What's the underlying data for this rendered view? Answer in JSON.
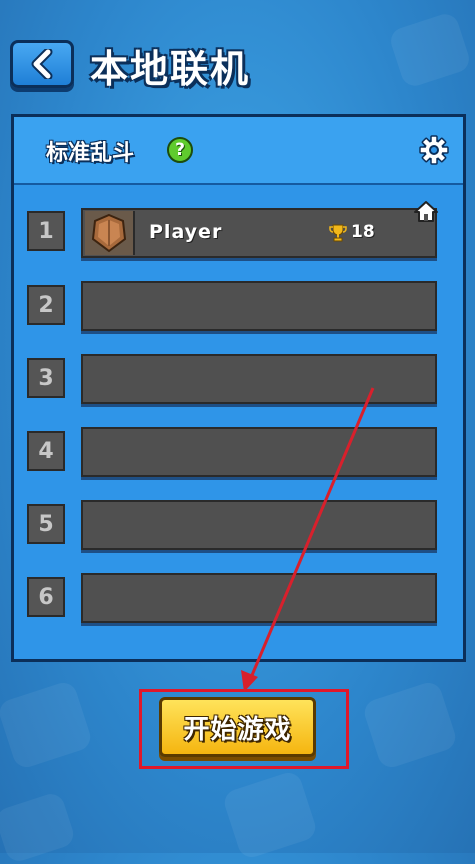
{
  "header": {
    "title": "本地联机",
    "back_icon": "chevron-left-icon"
  },
  "panel": {
    "mode_name": "标准乱斗",
    "help_symbol": "?",
    "settings_icon": "gear-icon"
  },
  "slots": [
    {
      "number": "1",
      "player_name": "Player",
      "trophies": "18",
      "avatar_icon": "shield-badge-icon",
      "host_icon": "home-icon"
    },
    {
      "number": "2"
    },
    {
      "number": "3"
    },
    {
      "number": "4"
    },
    {
      "number": "5"
    },
    {
      "number": "6"
    }
  ],
  "start_button": {
    "label": "开始游戏"
  },
  "colors": {
    "accent_blue": "#2f95e8",
    "start_yellow": "#f5b510",
    "highlight_red": "#e0182a",
    "help_green": "#5fcb2e"
  }
}
